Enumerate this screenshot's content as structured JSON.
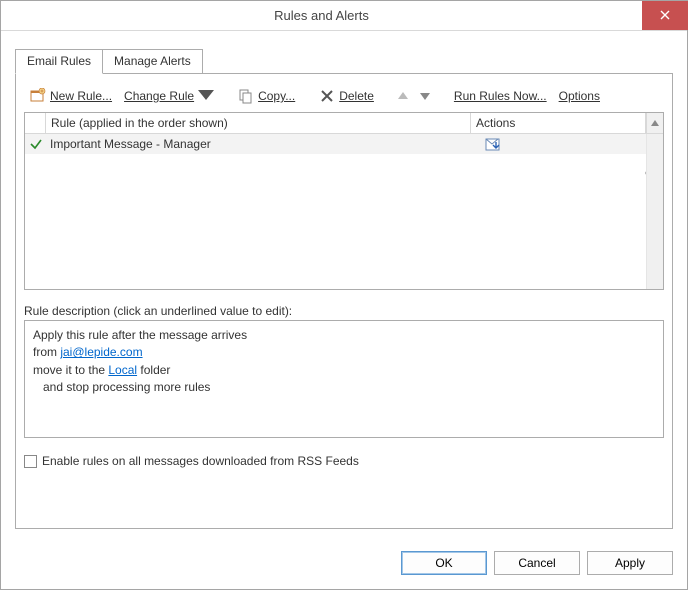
{
  "window": {
    "title": "Rules and Alerts"
  },
  "tabs": {
    "email_rules": "Email Rules",
    "manage_alerts": "Manage Alerts"
  },
  "toolbar": {
    "new_rule": "New Rule...",
    "change_rule": "Change Rule",
    "copy": "Copy...",
    "delete": "Delete",
    "run_rules": "Run Rules Now...",
    "options": "Options"
  },
  "grid": {
    "header_rule": "Rule (applied in the order shown)",
    "header_actions": "Actions",
    "rows": [
      {
        "name": "Important Message - Manager",
        "checked": true
      }
    ]
  },
  "description": {
    "label": "Rule description (click an underlined value to edit):",
    "line1": "Apply this rule after the message arrives",
    "line2_prefix": "from ",
    "line2_link": "jai@lepide.com",
    "line3_prefix": "move it to the ",
    "line3_link": "Local",
    "line3_suffix": " folder",
    "line4": "and stop processing more rules"
  },
  "rss_label": "Enable rules on all messages downloaded from RSS Feeds",
  "buttons": {
    "ok": "OK",
    "cancel": "Cancel",
    "apply": "Apply"
  }
}
